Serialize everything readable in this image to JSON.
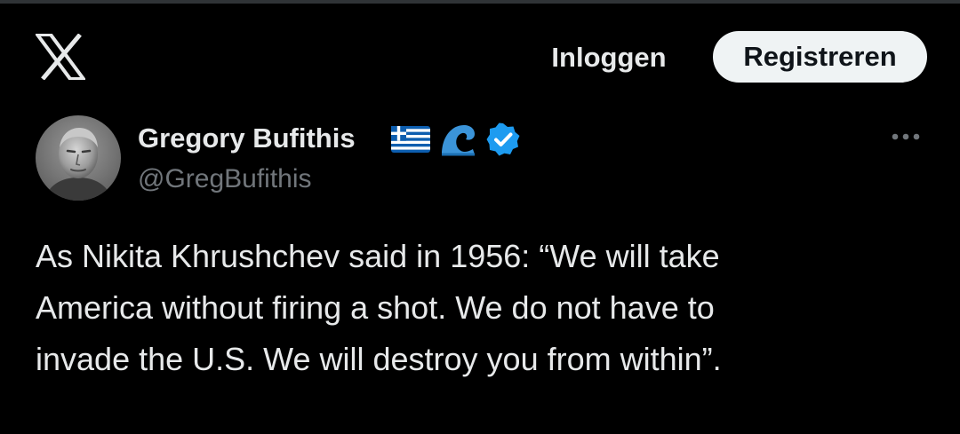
{
  "header": {
    "logo_icon": "x-logo-icon",
    "login_label": "Inloggen",
    "register_label": "Registreren"
  },
  "tweet": {
    "author": {
      "name": "Gregory Bufithis",
      "handle": "@GregBufithis",
      "badges": [
        "greek-flag-icon",
        "water-wave-icon",
        "verified-badge-icon"
      ]
    },
    "text_lines": [
      "As Nikita Khrushchev said in 1956: “We will take",
      "America without firing a shot. We do not have to",
      "invade the U.S. We will destroy you from within”."
    ],
    "more_icon": "ellipsis-icon"
  },
  "colors": {
    "background": "#000000",
    "primary_text": "#e7e9ea",
    "secondary_text": "#71767b",
    "button_bg": "#eff3f4",
    "verified_blue": "#1d9bf0",
    "wave_blue": "#3b94d9",
    "flag_blue": "#0d5eaf"
  }
}
